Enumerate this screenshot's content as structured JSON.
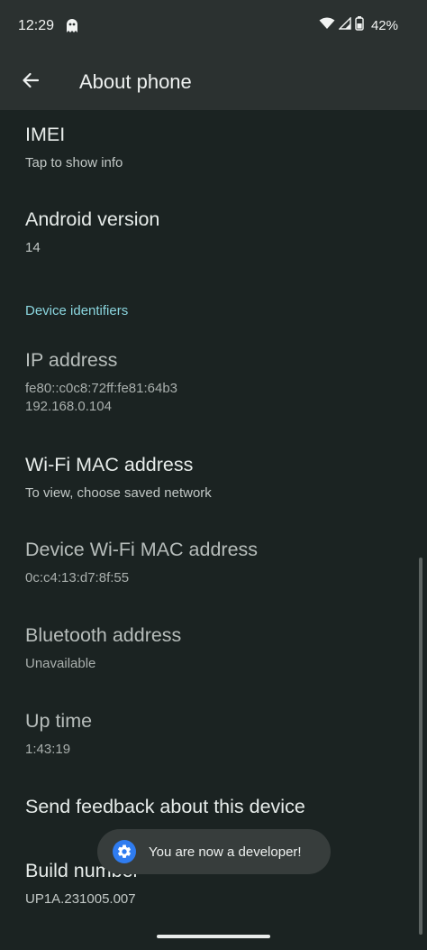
{
  "status_bar": {
    "time": "12:29",
    "left_icon": "ghost-app-icon",
    "icons": [
      "wifi-icon",
      "signal-icon",
      "battery-icon"
    ],
    "battery_percent": "42%"
  },
  "app_bar": {
    "back_icon": "arrow-back-icon",
    "title": "About phone"
  },
  "items": [
    {
      "title": "IMEI",
      "summary": "Tap to show info",
      "enabled": true
    },
    {
      "title": "Android version",
      "summary": "14",
      "enabled": true
    }
  ],
  "section": {
    "header": "Device identifiers"
  },
  "section_items": [
    {
      "title": "IP address",
      "summary": "fe80::c0c8:72ff:fe81:64b3\n192.168.0.104",
      "enabled": false
    },
    {
      "title": "Wi-Fi MAC address",
      "summary": "To view, choose saved network",
      "enabled": true
    },
    {
      "title": "Device Wi-Fi MAC address",
      "summary": "0c:c4:13:d7:8f:55",
      "enabled": false
    },
    {
      "title": "Bluetooth address",
      "summary": "Unavailable",
      "enabled": false
    },
    {
      "title": "Up time",
      "summary": "1:43:19",
      "enabled": false
    },
    {
      "title": "Send feedback about this device",
      "summary": "",
      "enabled": true
    },
    {
      "title": "Build number",
      "summary": "UP1A.231005.007",
      "enabled": true
    }
  ],
  "toast": {
    "icon": "settings-gear-icon",
    "text": "You are now a developer!"
  },
  "colors": {
    "background": "#1b2322",
    "app_bar": "#2b3130",
    "accent": "#8bd6df",
    "toast_icon": "#2f7cf0"
  }
}
